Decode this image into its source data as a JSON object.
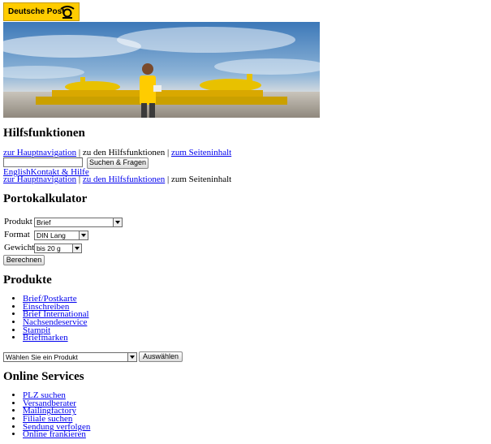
{
  "logo": {
    "text": "Deutsche Post"
  },
  "colors": {
    "brand_yellow": "#ffcc00",
    "link": "#0000ee"
  },
  "help": {
    "heading": "Hilfsfunktionen",
    "skip_main_nav": "zur Hauptnavigation",
    "sep1": " | zu den Hilfsfunktionen | ",
    "skip_content": "zum Seiteninhalt",
    "search_value": "",
    "search_button": "Suchen & Fragen",
    "english": "English",
    "contact": "Kontakt & Hilfe",
    "skip_main_nav_2": "zur Hauptnavigation",
    "sep2": " | ",
    "skip_help_2": "zu den Hilfsfunktionen",
    "sep3": " | zum Seiteninhalt"
  },
  "porto": {
    "heading": "Portokalkulator",
    "product_label": "Produkt",
    "product_value": "Brief",
    "format_label": "Format",
    "format_value": "DIN Lang",
    "weight_label": "Gewicht",
    "weight_value": "bis 20 g",
    "calc_button": "Berechnen"
  },
  "products": {
    "heading": "Produkte",
    "items": [
      "Brief/Postkarte",
      "Einschreiben",
      "Brief International",
      "Nachsendeservice",
      "Stampit",
      "Briefmarken"
    ],
    "select_value": "Wählen Sie ein Produkt",
    "select_button": "Auswählen"
  },
  "online": {
    "heading": "Online Services",
    "items": [
      "PLZ suchen",
      "Versandberater",
      "Mailingfactory",
      "Filiale suchen",
      "Sendung verfolgen",
      "Online frankieren"
    ]
  }
}
